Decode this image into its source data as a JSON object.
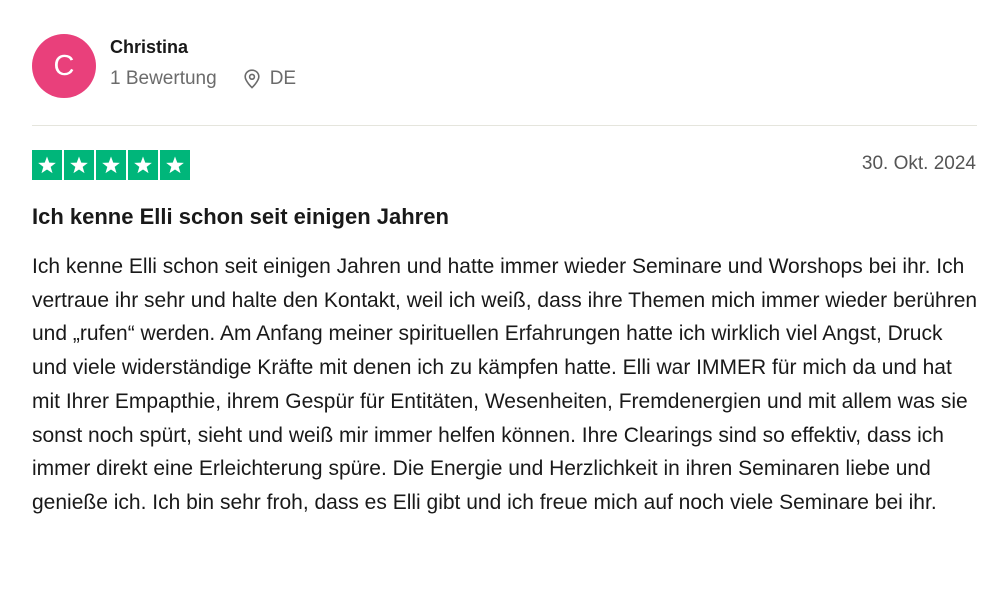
{
  "reviewer": {
    "avatar_letter": "C",
    "avatar_color": "#e9407b",
    "name": "Christina",
    "review_count": "1 Bewertung",
    "country": "DE"
  },
  "review": {
    "rating": 5,
    "rating_max": 5,
    "star_color": "#00b67a",
    "date": "30. Okt. 2024",
    "title": "Ich kenne Elli schon seit einigen Jahren",
    "text": "Ich kenne Elli schon seit einigen Jahren und hatte immer wieder Seminare und Worshops bei ihr. Ich vertraue ihr sehr und halte den Kontakt, weil ich weiß, dass ihre Themen mich immer wieder berühren und „rufen“ werden. Am Anfang meiner spirituellen Erfahrungen hatte ich wirklich viel Angst, Druck und viele widerständige Kräfte mit denen ich zu kämpfen hatte. Elli war IMMER für mich da und hat mit Ihrer Empapthie, ihrem Gespür für Entitäten, Wesenheiten, Fremdenergien und mit allem was sie sonst noch spürt, sieht und weiß mir immer helfen können. Ihre Clearings sind so effektiv, dass ich immer direkt eine Erleichterung spüre. Die Energie und Herzlichkeit in ihren Seminaren liebe und genieße ich. Ich bin sehr froh, dass es Elli gibt und ich freue mich auf noch viele Seminare bei ihr."
  },
  "icons": {
    "location": "location-pin-icon",
    "star": "star-icon"
  }
}
